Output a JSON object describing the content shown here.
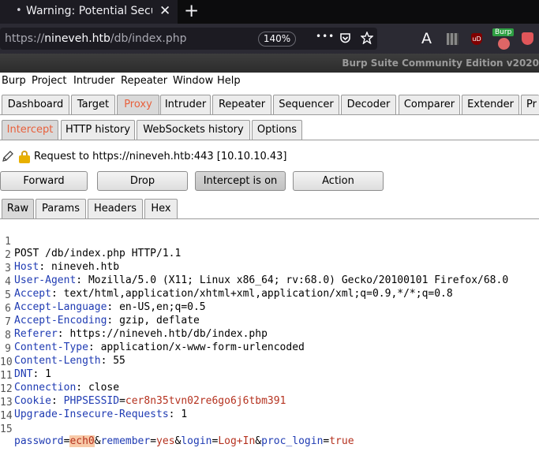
{
  "browser": {
    "tab_dot": "•",
    "tab_title": "Warning: Potential Security Risk Ahead",
    "tab_close": "✕",
    "new_tab": "+",
    "url_prefix": "https://",
    "url_host": "nineveh.htb",
    "url_path": "/db/index.php",
    "zoom": "140%",
    "more": "•••",
    "font_icon": "A",
    "burp_badge": "Burp",
    "ublock_label": "uD"
  },
  "burp": {
    "title": "Burp Suite Community Edition v2020",
    "menu": [
      "Burp",
      "Project",
      "Intruder",
      "Repeater",
      "Window",
      "Help"
    ],
    "main_tabs": [
      "Dashboard",
      "Target",
      "Proxy",
      "Intruder",
      "Repeater",
      "Sequencer",
      "Decoder",
      "Comparer",
      "Extender",
      "Pr"
    ],
    "proxy_tabs": [
      "Intercept",
      "HTTP history",
      "WebSockets history",
      "Options"
    ],
    "request_info": "Request to https://nineveh.htb:443  [10.10.10.43]",
    "buttons": {
      "forward": "Forward",
      "drop": "Drop",
      "intercept": "Intercept is on",
      "action": "Action"
    },
    "message_tabs": [
      "Raw",
      "Params",
      "Headers",
      "Hex"
    ]
  },
  "request": {
    "request_line": "POST /db/index.php HTTP/1.1",
    "headers": [
      {
        "name": "Host",
        "value": "nineveh.htb"
      },
      {
        "name": "User-Agent",
        "value": "Mozilla/5.0 (X11; Linux x86_64; rv:68.0) Gecko/20100101 Firefox/68.0"
      },
      {
        "name": "Accept",
        "value": "text/html,application/xhtml+xml,application/xml;q=0.9,*/*;q=0.8"
      },
      {
        "name": "Accept-Language",
        "value": "en-US,en;q=0.5"
      },
      {
        "name": "Accept-Encoding",
        "value": "gzip, deflate"
      },
      {
        "name": "Referer",
        "value": "https://nineveh.htb/db/index.php"
      },
      {
        "name": "Content-Type",
        "value": "application/x-www-form-urlencoded"
      },
      {
        "name": "Content-Length",
        "value": "55"
      },
      {
        "name": "DNT",
        "value": "1"
      },
      {
        "name": "Connection",
        "value": "close"
      },
      {
        "name": "Cookie",
        "cookie_name": "PHPSESSID",
        "cookie_value": "cer8n35tvn02re6go6j6tbm391"
      },
      {
        "name": "Upgrade-Insecure-Requests",
        "value": "1"
      }
    ],
    "body": [
      {
        "key": "password",
        "value": "ech0",
        "highlight": true
      },
      {
        "key": "remember",
        "value": "yes"
      },
      {
        "key": "login",
        "value": "Log+In"
      },
      {
        "key": "proc_login",
        "value": "true"
      }
    ],
    "line_numbers": [
      "1",
      "2",
      "3",
      "4",
      "5",
      "6",
      "7",
      "8",
      "9",
      "10",
      "11",
      "12",
      "13",
      "14",
      "15"
    ]
  },
  "colors": {
    "accent_selected_tab": "#e8603c",
    "header_name": "#1f3bb3",
    "param_value": "#b5321f",
    "highlight": "#f8c9a7"
  }
}
